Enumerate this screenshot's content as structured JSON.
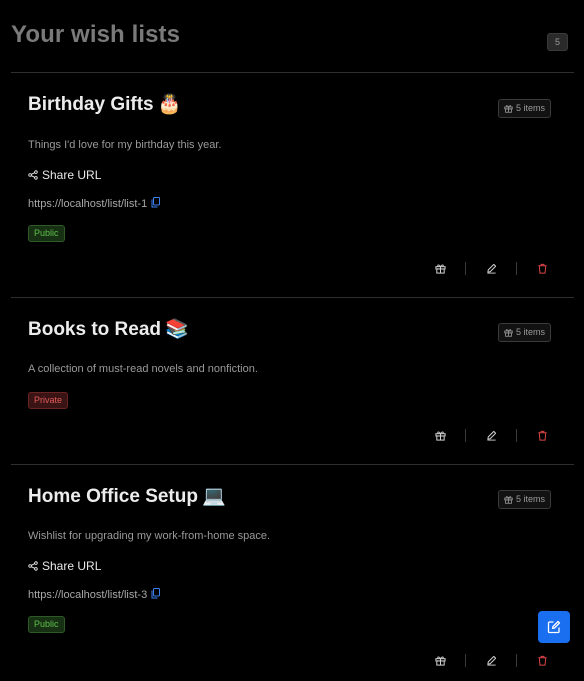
{
  "page": {
    "title": "Your wish lists",
    "count": "5"
  },
  "colors": {
    "background": "#000000",
    "accent": "#1a6ef0",
    "public": "#5ec04a",
    "private": "#e25a5a",
    "delete": "#d94545",
    "link_icon": "#3b82f6"
  },
  "lists": [
    {
      "title": "Birthday Gifts",
      "emoji": "🎂",
      "items_badge": "5 items",
      "description": "Things I'd love for my birthday this year.",
      "share_label": "Share URL",
      "url": "https://localhost/list/list-1",
      "visibility": "Public"
    },
    {
      "title": "Books to Read",
      "emoji": "📚",
      "items_badge": "5 items",
      "description": "A collection of must-read novels and nonfiction.",
      "visibility": "Private"
    },
    {
      "title": "Home Office Setup",
      "emoji": "💻",
      "items_badge": "5 items",
      "description": "Wishlist for upgrading my work-from-home space.",
      "share_label": "Share URL",
      "url": "https://localhost/list/list-3",
      "visibility": "Public"
    }
  ],
  "icons": {
    "items": "gift-icon",
    "share": "share-icon",
    "copy": "copy-icon",
    "view": "gift-icon",
    "edit": "pencil-icon",
    "delete": "trash-icon",
    "fab": "edit-square-icon"
  }
}
